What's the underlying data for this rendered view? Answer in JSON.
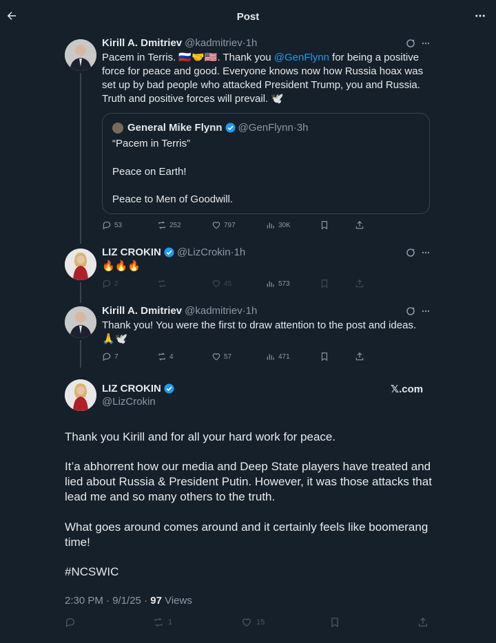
{
  "header": {
    "title": "Post"
  },
  "tweets": [
    {
      "name": "Kirill A. Dmitriev",
      "handle": "@kadmitriev",
      "time": "·1h",
      "text_lines": [
        "Pacem in Terris. 🇷🇺🤝🇺🇸. Thank you @GenFlynn for being a positive",
        "force for peace and good. Everyone knows now how Russia hoax was",
        "set up by bad people who attacked President Trump, you and Russia.",
        "Truth and positive forces will prevail. 🕊️"
      ],
      "mention": "@GenFlynn",
      "quote": {
        "name": "General Mike Flynn",
        "handle": "@GenFlynn",
        "time": "·3h",
        "line1": "“Pacem in Terris”",
        "line2": "Peace on Earth!",
        "line3": "Peace to Men of Goodwill."
      },
      "stats": {
        "replies": "53",
        "reposts": "252",
        "likes": "797",
        "views": "30K"
      }
    },
    {
      "name": "LIZ CROKIN",
      "handle": "@LizCrokin",
      "time": "·1h",
      "text": "🔥🔥🔥",
      "stats": {
        "replies": "2",
        "reposts": "",
        "likes": "45",
        "views": "573"
      }
    },
    {
      "name": "Kirill A. Dmitriev",
      "handle": "@kadmitriev",
      "time": "·1h",
      "text_line1": "Thank you! You were the first to draw attention to the post and ideas.",
      "text_line2": "🙏🕊️",
      "stats": {
        "replies": "7",
        "reposts": "4",
        "likes": "57",
        "views": "471"
      }
    }
  ],
  "main_post": {
    "name": "LIZ CROKIN",
    "handle": "@LizCrokin",
    "watermark": "𝕏.com",
    "paragraph1": "Thank you Kirill and for all your hard work for peace.",
    "paragraph2_lines": [
      "It’a abhorrent how our media and Deep State players have treated and",
      "lied about Russia & President Putin. However, it was those attacks that",
      "lead me and so many others to the truth."
    ],
    "paragraph3_lines": [
      "What goes around comes around and it certainly feels like boomerang",
      "time!"
    ],
    "hashtag": "#NCSWIC",
    "timestamp": "2:30 PM · 9/1/25 · ",
    "views_count": "97",
    "views_label": " Views",
    "stats": {
      "reposts": "1",
      "likes": "15"
    }
  },
  "icons": [
    "back-arrow-icon",
    "more-icon",
    "grok-icon",
    "verified-badge-icon",
    "reply-icon",
    "repost-icon",
    "like-icon",
    "views-icon",
    "bookmark-icon",
    "share-icon"
  ],
  "colors": {
    "background": "#15202b",
    "accent": "#1d9bf0",
    "muted": "#8b98a5",
    "text": "#e7e9ea",
    "border": "#38444d"
  }
}
